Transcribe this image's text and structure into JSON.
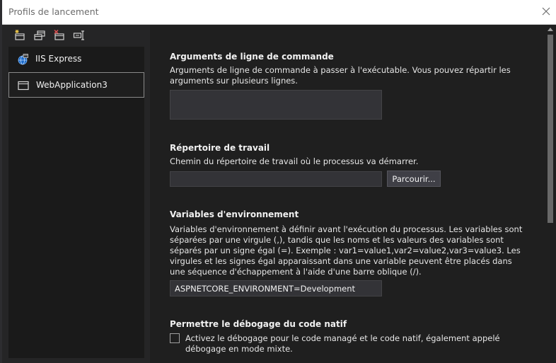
{
  "window": {
    "title": "Profils de lancement"
  },
  "toolbar": {
    "buttons": [
      {
        "name": "new-profile-icon"
      },
      {
        "name": "copy-profile-icon"
      },
      {
        "name": "delete-profile-icon"
      },
      {
        "name": "rename-profile-icon"
      }
    ]
  },
  "profiles": [
    {
      "label": "IIS Express",
      "icon": "globe-icon",
      "selected": false
    },
    {
      "label": "WebApplication3",
      "icon": "window-icon",
      "selected": true
    }
  ],
  "sections": {
    "args": {
      "title": "Arguments de ligne de commande",
      "description": "Arguments de ligne de commande à passer à l'exécutable. Vous pouvez répartir les arguments sur plusieurs lignes.",
      "value": ""
    },
    "workdir": {
      "title": "Répertoire de travail",
      "description": "Chemin du répertoire de travail où le processus va démarrer.",
      "value": "",
      "browse_label": "Parcourir..."
    },
    "env": {
      "title": "Variables d'environnement",
      "description": "Variables d'environnement à définir avant l'exécution du processus. Les variables sont séparées par une virgule (,), tandis que les noms et les valeurs des variables sont séparés par un signe égal (=). Exemple : var1=value1,var2=value2,var3=value3. Les virgules et les signes égal apparaissant dans une variable peuvent être placés dans une séquence d'échappement à l'aide d'une barre oblique (/).",
      "value": "ASPNETCORE_ENVIRONMENT=Development"
    },
    "native": {
      "title": "Permettre le débogage du code natif",
      "checkbox_label": "Activez le débogage pour le code managé et le code natif, également appelé débogage en mode mixte.",
      "checked": false
    }
  },
  "colors": {
    "background": "#1f1f1f",
    "pane": "#252526",
    "list": "#1a1a1a",
    "input": "#333337",
    "text": "#f1f1f1"
  }
}
